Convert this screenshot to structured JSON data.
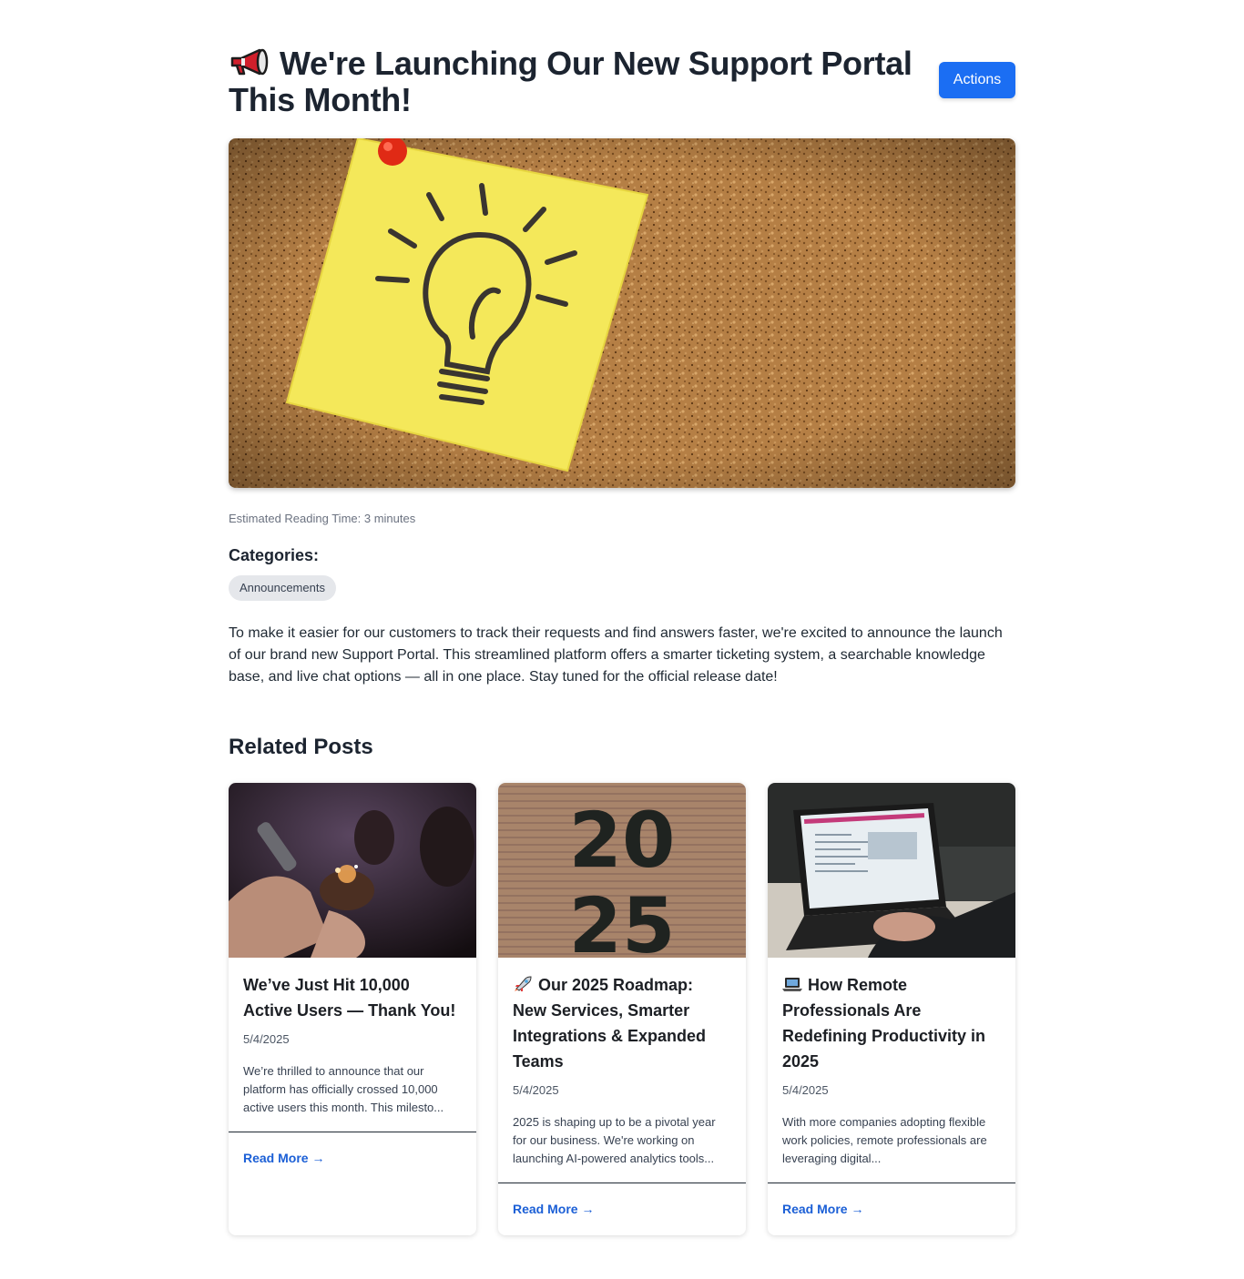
{
  "post": {
    "title": "We're Launching Our New Support Portal This Month!",
    "title_icon": "megaphone-icon",
    "actions_label": "Actions",
    "reading_time": "Estimated Reading Time: 3 minutes",
    "categories_heading": "Categories:",
    "categories": [
      "Announcements"
    ],
    "body": "To make it easier for our customers to track their requests and find answers faster, we're excited to announce the launch of our brand new Support Portal. This streamlined platform offers a smarter ticketing system, a searchable knowledge base, and live chat options — all in one place. Stay tuned for the official release date!"
  },
  "related": {
    "heading": "Related Posts",
    "posts": [
      {
        "icon": "",
        "title": "We’ve Just Hit 10,000 Active Users — Thank You!",
        "date": "5/4/2025",
        "excerpt": "We’re thrilled to announce that our platform has officially crossed 10,000 active users this month. This milesto...",
        "link": "Read More →"
      },
      {
        "icon": "rocket-icon",
        "title": "Our 2025 Roadmap: New Services, Smarter Integrations & Expanded Teams",
        "date": "5/4/2025",
        "excerpt": "2025 is shaping up to be a pivotal year for our business. We're working on launching AI-powered analytics tools...",
        "link": "Read More →",
        "image_text_top": "20",
        "image_text_bottom": "25"
      },
      {
        "icon": "laptop-icon",
        "title": "How Remote Professionals Are Redefining Productivity in 2025",
        "date": "5/4/2025",
        "excerpt": "With more companies adopting flexible work policies, remote professionals are leveraging digital...",
        "link": "Read More →"
      }
    ]
  },
  "colors": {
    "accent": "#1b6ef3",
    "link": "#1b5fd6",
    "chip_bg": "#e5e7eb"
  }
}
